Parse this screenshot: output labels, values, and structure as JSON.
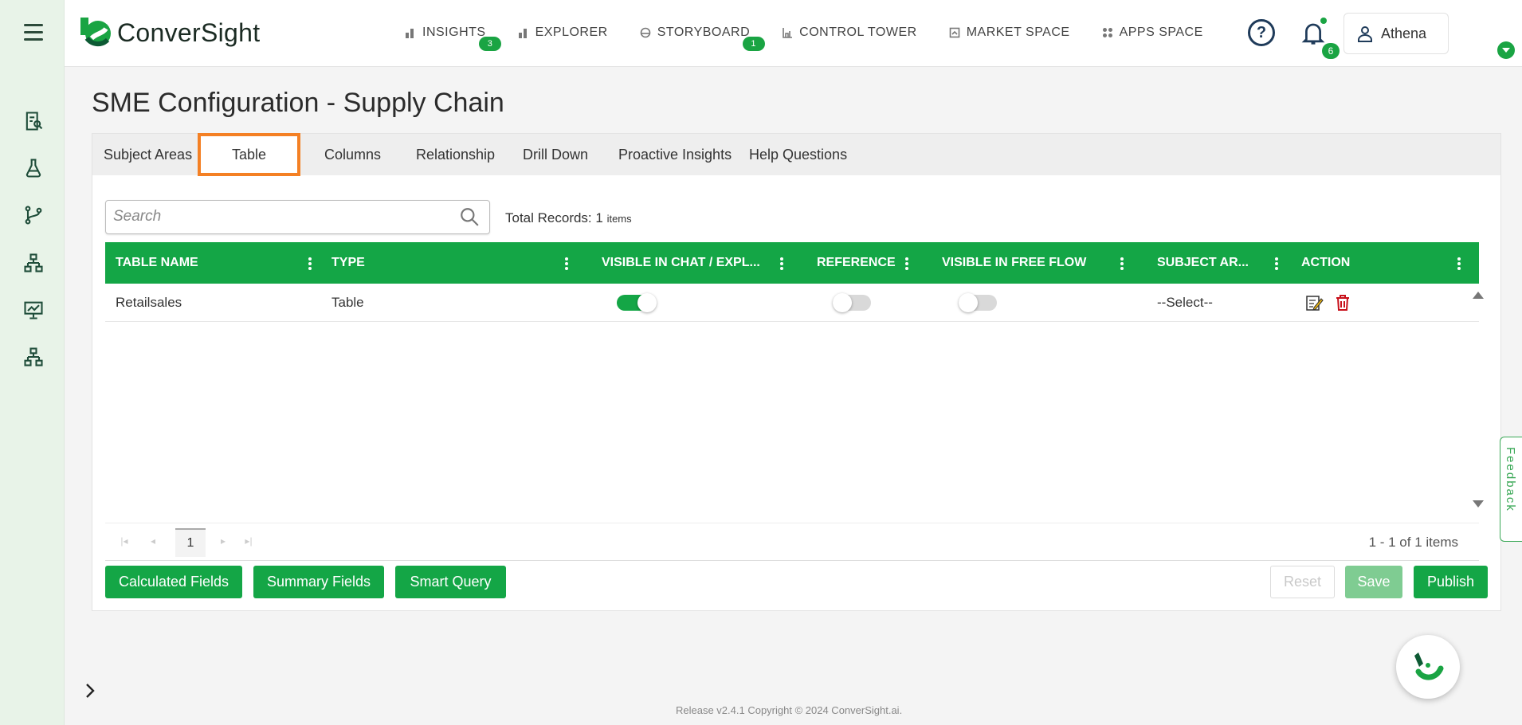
{
  "app": {
    "brand": "ConverSight",
    "accent": "#14a646",
    "highlight": "#f48024"
  },
  "nav": [
    {
      "label": "INSIGHTS",
      "icon": "bar-chart-icon",
      "badge": "3"
    },
    {
      "label": "EXPLORER",
      "icon": "bar-chart-icon",
      "badge": ""
    },
    {
      "label": "STORYBOARD",
      "icon": "storyboard-icon",
      "badge": "1"
    },
    {
      "label": "CONTROL TOWER",
      "icon": "control-tower-icon",
      "badge": ""
    },
    {
      "label": "MARKET SPACE",
      "icon": "market-space-icon",
      "badge": ""
    },
    {
      "label": "APPS SPACE",
      "icon": "apps-space-icon",
      "badge": ""
    }
  ],
  "header": {
    "notifications": "6",
    "user": "Athena"
  },
  "page": {
    "title": "SME Configuration - Supply Chain"
  },
  "tabs": [
    "Subject Areas",
    "Table",
    "Columns",
    "Relationship",
    "Drill Down",
    "Proactive Insights",
    "Help Questions"
  ],
  "active_tab": "Table",
  "search": {
    "placeholder": "Search",
    "value": ""
  },
  "total": {
    "label": "Total Records: 1",
    "unit": "items"
  },
  "grid": {
    "columns": [
      "TABLE NAME",
      "TYPE",
      "VISIBLE IN CHAT / EXPL...",
      "REFERENCE",
      "VISIBLE IN FREE FLOW",
      "SUBJECT AR...",
      "ACTION"
    ],
    "rows": [
      {
        "table_name": "Retailsales",
        "type": "Table",
        "visible_in_chat": true,
        "reference": false,
        "visible_in_free_flow": false,
        "subject_area": "--Select--"
      }
    ]
  },
  "pager": {
    "page": "1",
    "info": "1 - 1 of 1 items"
  },
  "buttons": {
    "calculated": "Calculated Fields",
    "summary": "Summary Fields",
    "smart_query": "Smart Query",
    "reset": "Reset",
    "save": "Save",
    "publish": "Publish"
  },
  "feedback": "Feedback",
  "footer": "Release v2.4.1 Copyright © 2024 ConverSight.ai."
}
